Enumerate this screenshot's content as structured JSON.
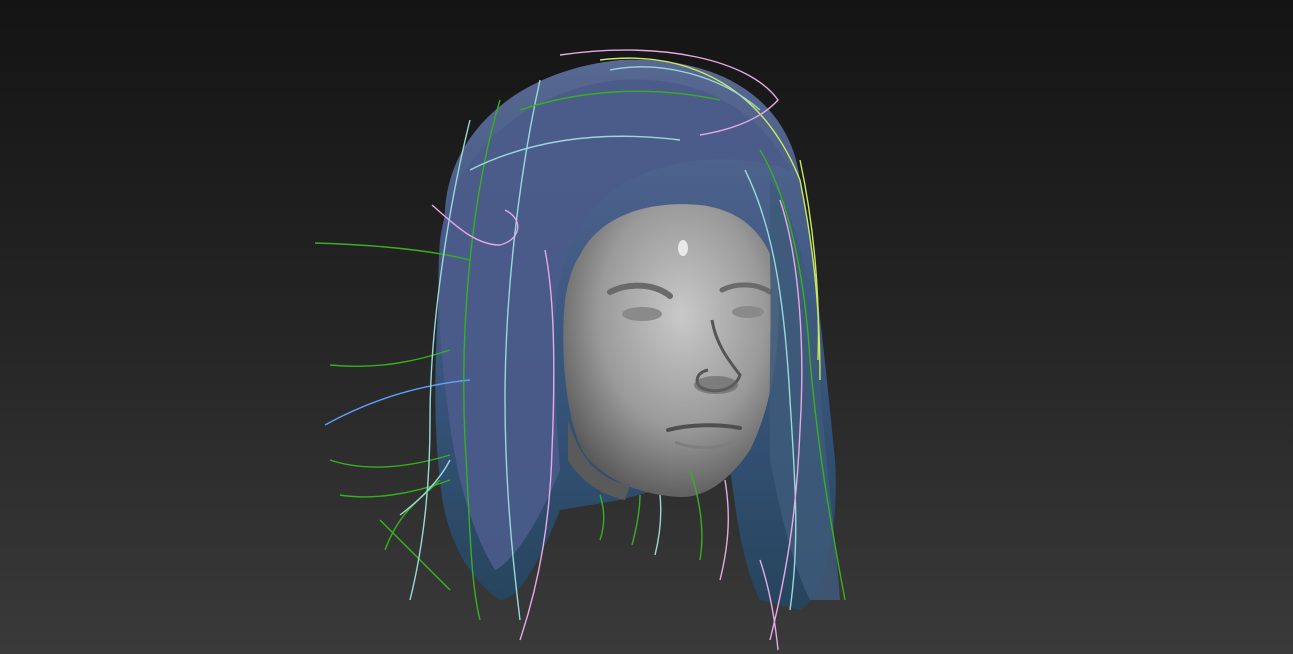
{
  "viewport": {
    "background_top": "#141414",
    "background_bottom": "#3a3a3a"
  },
  "model": {
    "icon": "hair-strand-head-model",
    "skin_color": "#a9a9a9",
    "hair_base_color": "#4a5f86",
    "guide_colors": [
      "#36b020",
      "#9ad8d8",
      "#e6a9e6",
      "#c9e860",
      "#5fa0ff"
    ]
  }
}
